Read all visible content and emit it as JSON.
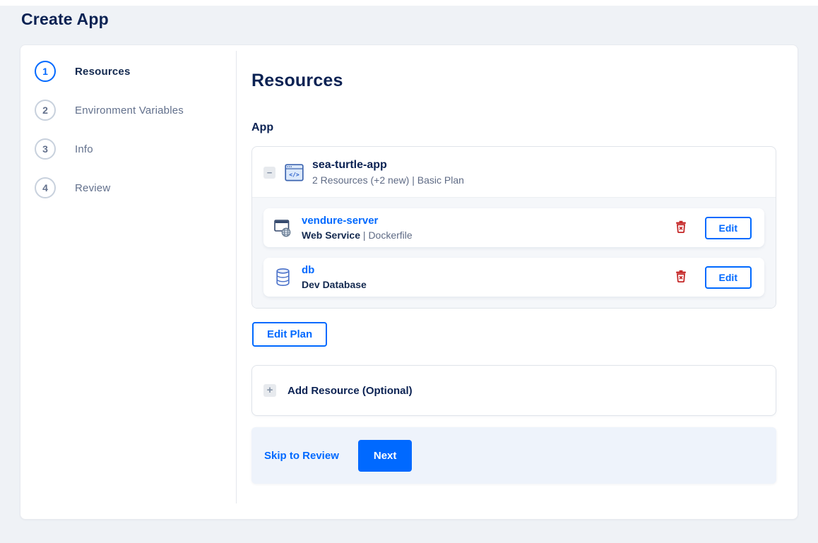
{
  "page": {
    "title": "Create App"
  },
  "stepper": {
    "steps": [
      {
        "number": "1",
        "label": "Resources"
      },
      {
        "number": "2",
        "label": "Environment Variables"
      },
      {
        "number": "3",
        "label": "Info"
      },
      {
        "number": "4",
        "label": "Review"
      }
    ]
  },
  "content": {
    "heading": "Resources",
    "section_label": "App",
    "app_card": {
      "collapse_glyph": "−",
      "name": "sea-turtle-app",
      "summary": "2 Resources (+2 new) | Basic Plan",
      "resources": [
        {
          "name": "vendure-server",
          "type": "Web Service",
          "separator": " | ",
          "detail": "Dockerfile",
          "icon": "web-service-icon",
          "edit_label": "Edit"
        },
        {
          "name": "db",
          "type": "Dev Database",
          "separator": "",
          "detail": "",
          "icon": "database-icon",
          "edit_label": "Edit"
        }
      ]
    },
    "edit_plan_label": "Edit Plan",
    "add_resource": {
      "plus_glyph": "+",
      "label": "Add Resource (Optional)"
    },
    "footer": {
      "skip_label": "Skip to Review",
      "next_label": "Next"
    }
  },
  "colors": {
    "accent_blue": "#0069ff",
    "heading_navy": "#0b2253",
    "muted_gray": "#5f6b85",
    "danger_red": "#c42626",
    "page_bg": "#eff2f6",
    "card_body_bg": "#f5f7fa",
    "footer_bg": "#eef3fb"
  }
}
